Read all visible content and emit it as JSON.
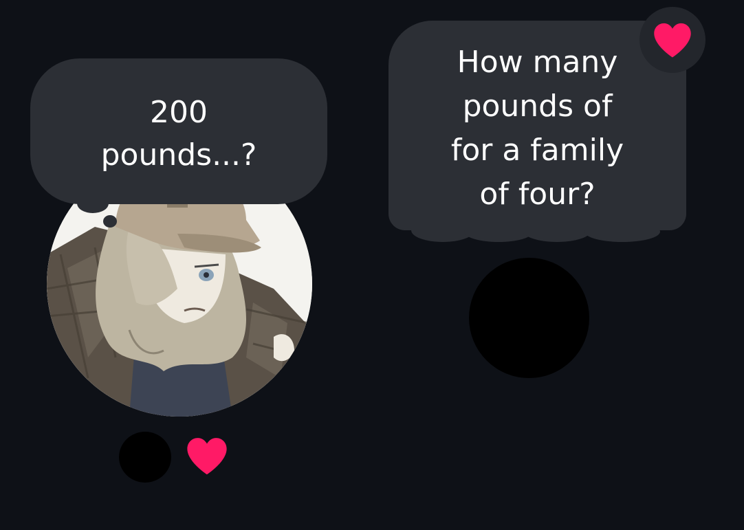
{
  "messages": {
    "left": {
      "text": "200\npounds...?",
      "avatar_icon": "character-avatar-icon"
    },
    "right": {
      "text": "How many\npounds of\nfor a family\nof four?",
      "liked": true,
      "avatar_icon": "redacted-avatar-icon"
    }
  },
  "reactions": {
    "heart_icon": "heart-icon",
    "heart_color": "#ff1a66"
  },
  "colors": {
    "background": "#0e1117",
    "bubble": "#2c2f35",
    "text": "#ffffff"
  }
}
